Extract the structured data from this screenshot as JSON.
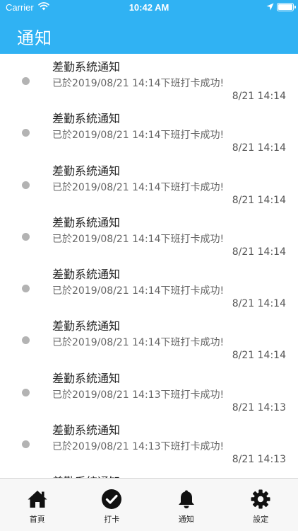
{
  "status_bar": {
    "carrier": "Carrier",
    "time": "10:42 AM"
  },
  "header": {
    "title": "通知"
  },
  "notifications": [
    {
      "title": "差勤系統通知",
      "body": "已於2019/08/21 14:14下班打卡成功!",
      "time": "8/21 14:14"
    },
    {
      "title": "差勤系統通知",
      "body": "已於2019/08/21 14:14下班打卡成功!",
      "time": "8/21 14:14"
    },
    {
      "title": "差勤系統通知",
      "body": "已於2019/08/21 14:14下班打卡成功!",
      "time": "8/21 14:14"
    },
    {
      "title": "差勤系統通知",
      "body": "已於2019/08/21 14:14下班打卡成功!",
      "time": "8/21 14:14"
    },
    {
      "title": "差勤系統通知",
      "body": "已於2019/08/21 14:14下班打卡成功!",
      "time": "8/21 14:14"
    },
    {
      "title": "差勤系統通知",
      "body": "已於2019/08/21 14:14下班打卡成功!",
      "time": "8/21 14:14"
    },
    {
      "title": "差勤系統通知",
      "body": "已於2019/08/21 14:13下班打卡成功!",
      "time": "8/21 14:13"
    },
    {
      "title": "差勤系統通知",
      "body": "已於2019/08/21 14:13下班打卡成功!",
      "time": "8/21 14:13"
    },
    {
      "title": "差勤系統通知",
      "body": "",
      "time": ""
    }
  ],
  "tabs": [
    {
      "label": "首頁",
      "icon": "home-icon"
    },
    {
      "label": "打卡",
      "icon": "check-circle-icon"
    },
    {
      "label": "通知",
      "icon": "bell-icon"
    },
    {
      "label": "設定",
      "icon": "gear-icon"
    }
  ],
  "colors": {
    "header": "#30b2f3",
    "dot": "#b3b3b3",
    "tabbar": "#f7f7f7"
  }
}
